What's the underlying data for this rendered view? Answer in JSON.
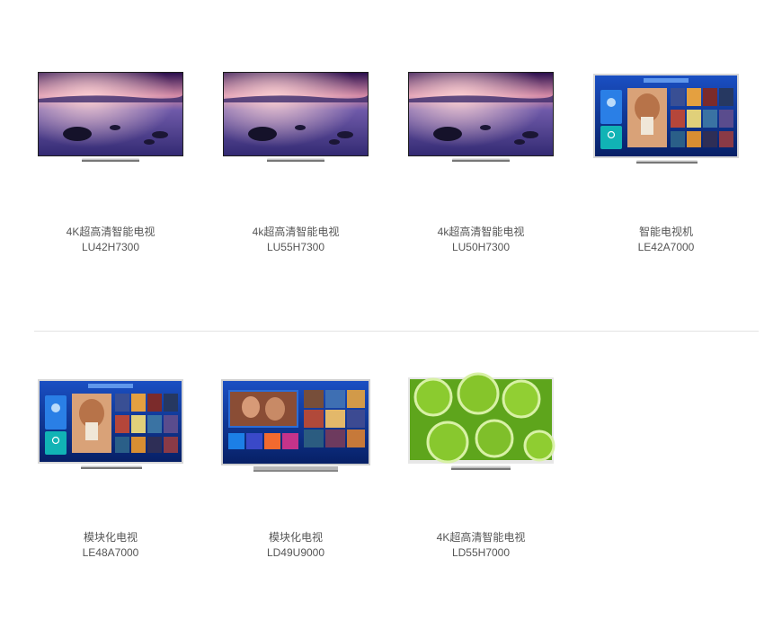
{
  "products": [
    {
      "name": "4K超高清智能电视",
      "model": "LU42H7300"
    },
    {
      "name": "4k超高清智能电视",
      "model": "LU55H7300"
    },
    {
      "name": "4k超高清智能电视",
      "model": "LU50H7300"
    },
    {
      "name": "智能电视机",
      "model": "LE42A7000"
    },
    {
      "name": "模块化电视",
      "model": "LE48A7000"
    },
    {
      "name": "模块化电视",
      "model": "LD49U9000"
    },
    {
      "name": "4K超高清智能电视",
      "model": "LD55H7000"
    }
  ],
  "colors": {
    "text": "#555555",
    "divider": "#e3e3e3",
    "screen_ui_blue": "#0b2f8f",
    "lime_green": "#7fc22c"
  },
  "icons": [
    "tv-product-image"
  ]
}
